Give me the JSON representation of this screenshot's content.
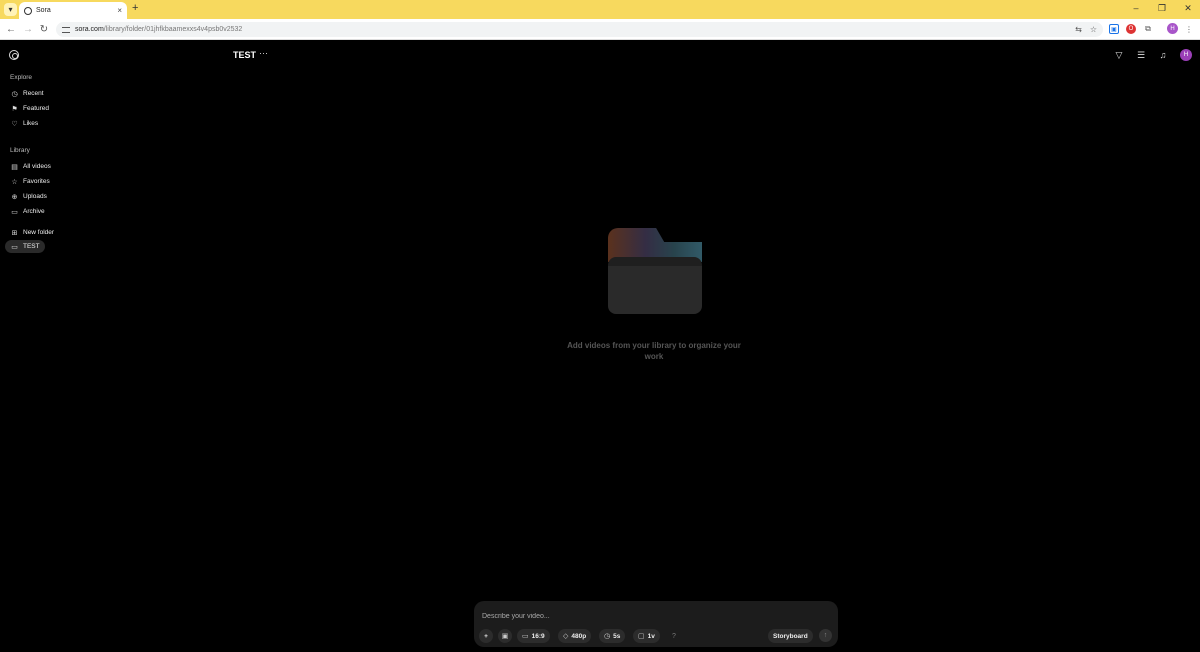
{
  "browser": {
    "tab_title": "Sora",
    "tab_close": "×",
    "new_tab": "+",
    "url_domain": "sora.com",
    "url_path": "/library/folder/01jhfkbaamexxs4v4psb0v2532",
    "profile_initial": "H",
    "controls": {
      "minimize": "–",
      "restore": "❐",
      "close": "✕"
    }
  },
  "sidebar": {
    "explore_label": "Explore",
    "explore_items": [
      {
        "label": "Recent",
        "icon": "clock-icon"
      },
      {
        "label": "Featured",
        "icon": "featured-icon"
      },
      {
        "label": "Likes",
        "icon": "heart-icon"
      }
    ],
    "library_label": "Library",
    "library_items": [
      {
        "label": "All videos",
        "icon": "grid-icon"
      },
      {
        "label": "Favorites",
        "icon": "star-icon"
      },
      {
        "label": "Uploads",
        "icon": "upload-icon"
      },
      {
        "label": "Archive",
        "icon": "archive-icon"
      }
    ],
    "folder_items": [
      {
        "label": "New folder",
        "icon": "new-folder-icon"
      },
      {
        "label": "TEST",
        "icon": "folder-icon",
        "active": true
      }
    ]
  },
  "header": {
    "title": "TEST",
    "more": "···",
    "avatar_initial": "H"
  },
  "empty_state": {
    "message": "Add videos from your library to organize your work"
  },
  "composer": {
    "placeholder": "Describe your video...",
    "aspect_ratio": "16:9",
    "resolution": "480p",
    "duration": "5s",
    "variations": "1v",
    "help": "?",
    "storyboard": "Storyboard"
  }
}
